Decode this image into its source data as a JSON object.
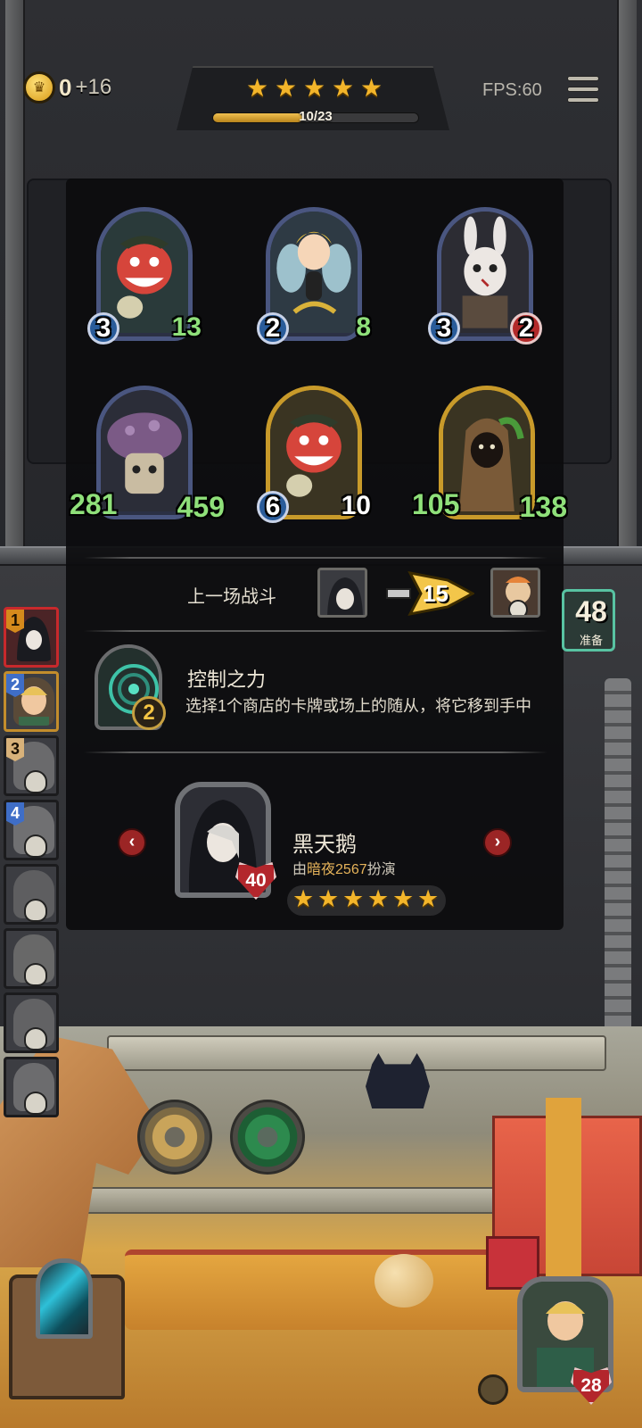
{
  "hud": {
    "gold": "0",
    "gold_bonus": "+16",
    "tier_stars": 5,
    "xp_text": "10/23",
    "xp_progress": 0.435,
    "fps": "FPS:60"
  },
  "timer": {
    "value": "48",
    "label": "准备"
  },
  "minions": [
    {
      "attack": "3",
      "health": "13",
      "golden": false,
      "big": false
    },
    {
      "attack": "2",
      "health": "8",
      "golden": false,
      "big": false
    },
    {
      "attack": "3",
      "health": "2",
      "golden": false,
      "big": false,
      "hp_badge": true
    },
    {
      "attack": "281",
      "health": "459",
      "golden": false,
      "big": true
    },
    {
      "attack": "6",
      "health": "10",
      "golden": true,
      "big": false
    },
    {
      "attack": "105",
      "health": "138",
      "golden": true,
      "big": true
    }
  ],
  "last_battle": {
    "label": "上一场战斗",
    "damage": "15"
  },
  "hero_power": {
    "name": "控制之力",
    "cost": "2",
    "description": "选择1个商店的卡牌或场上的随从，将它移到手中"
  },
  "hero": {
    "name": "黑天鹅",
    "by_prefix": "由",
    "player": "暗夜2567",
    "by_suffix": "扮演",
    "health": "40",
    "stars": 6
  },
  "leaderboard": [
    {
      "rank": "1",
      "rank_style": "gold",
      "dead": false,
      "active": true
    },
    {
      "rank": "2",
      "rank_style": "blue",
      "dead": false,
      "me": true
    },
    {
      "rank": "3",
      "rank_style": "tan",
      "dead": true
    },
    {
      "rank": "4",
      "rank_style": "blue",
      "dead": true
    },
    {
      "rank": "",
      "rank_style": "",
      "dead": true
    },
    {
      "rank": "",
      "rank_style": "",
      "dead": true
    },
    {
      "rank": "",
      "rank_style": "",
      "dead": true
    },
    {
      "rank": "",
      "rank_style": "",
      "dead": true
    }
  ],
  "player": {
    "health": "28"
  },
  "colors": {
    "star": "#f3b52a",
    "health_green": "#8fe07a",
    "accent_red": "#b3262c",
    "player_name": "#e6b35a"
  }
}
